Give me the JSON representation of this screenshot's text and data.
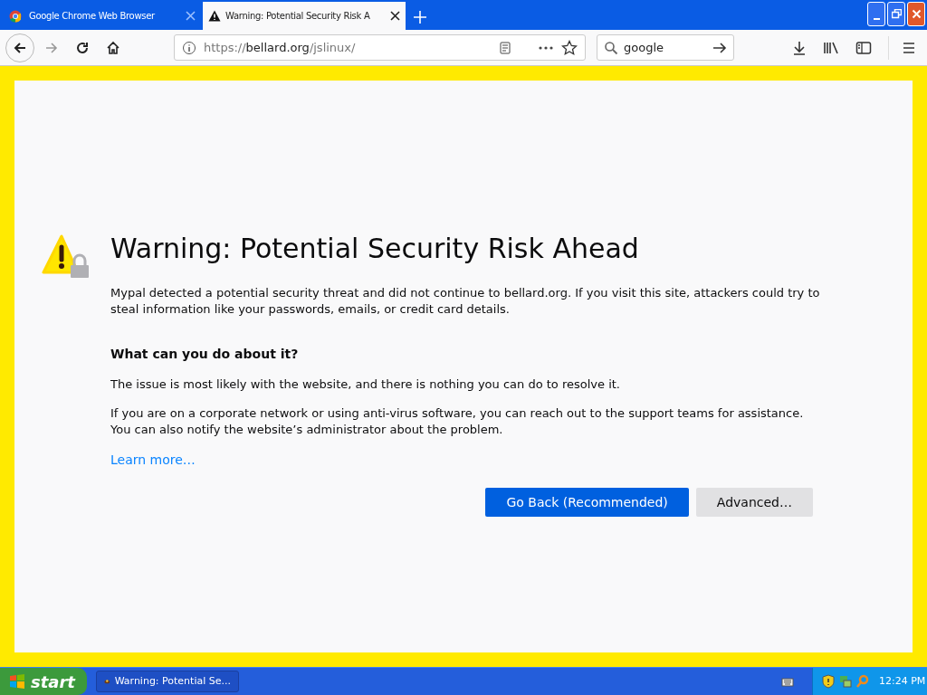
{
  "tabs": [
    {
      "title": "Google Chrome Web Browser",
      "selected": false,
      "kind": "chrome"
    },
    {
      "title": "Warning: Potential Security Risk A",
      "selected": true,
      "kind": "warning"
    }
  ],
  "address_bar": {
    "url_prefix": "https://",
    "url_host": "bellard.org",
    "url_path": "/jslinux/"
  },
  "search_bar": {
    "value": "google"
  },
  "error_page": {
    "title": "Warning: Potential Security Risk Ahead",
    "intro": "Mypal detected a potential security threat and did not continue to bellard.org. If you visit this site, attackers could try to steal information like your passwords, emails, or credit card details.",
    "heading": "What can you do about it?",
    "paragraphs": [
      "The issue is most likely with the website, and there is nothing you can do to resolve it.",
      "If you are on a corporate network or using anti-virus software, you can reach out to the support teams for assistance. You can also notify the website’s administrator about the problem."
    ],
    "learn_more": "Learn more…",
    "buttons": [
      {
        "label": "Go Back (Recommended)",
        "kind": "primary"
      },
      {
        "label": "Advanced…",
        "kind": "secondary"
      }
    ]
  },
  "taskbar": {
    "start": "start",
    "tasks": [
      "Warning: Potential Se..."
    ],
    "clock": "12:24 PM"
  }
}
